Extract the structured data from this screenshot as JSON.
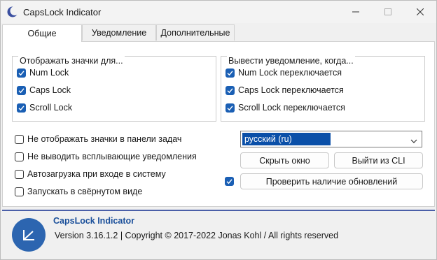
{
  "window": {
    "title": "CapsLock Indicator"
  },
  "tabs": [
    {
      "label": "Общие",
      "active": true
    },
    {
      "label": "Уведомление",
      "active": false
    },
    {
      "label": "Дополнительные",
      "active": false
    }
  ],
  "show_icons": {
    "title": "Отображать значки для...",
    "items": [
      {
        "label": "Num Lock",
        "checked": true
      },
      {
        "label": "Caps Lock",
        "checked": true
      },
      {
        "label": "Scroll Lock",
        "checked": true
      }
    ]
  },
  "notify": {
    "title": "Вывести уведомление, когда...",
    "items": [
      {
        "label": "Num Lock переключается",
        "checked": true
      },
      {
        "label": "Caps Lock переключается",
        "checked": true
      },
      {
        "label": "Scroll Lock переключается",
        "checked": true
      }
    ]
  },
  "options": [
    {
      "label": "Не отображать значки в панели задач",
      "checked": false
    },
    {
      "label": "Не выводить всплывающие уведомления",
      "checked": false
    },
    {
      "label": "Автозагрузка при входе в систему",
      "checked": false
    },
    {
      "label": "Запускать в свёрнутом виде",
      "checked": false
    }
  ],
  "language": {
    "value": "русский (ru)"
  },
  "buttons": {
    "hide_window": "Скрыть окно",
    "exit_cli": "Выйти из CLI",
    "check_updates": "Проверить наличие обновлений"
  },
  "check_updates_checked": true,
  "about": {
    "name": "CapsLock Indicator",
    "version": "Version 3.16.1.2 | Copyright © 2017-2022 Jonas Kohl / All rights reserved"
  },
  "colors": {
    "accent": "#1a5fb4",
    "selection": "#0a4fa8",
    "divider": "#4a5fa8",
    "logo": "#2c65b0"
  },
  "icons": {
    "app": "crescent-moon-icon",
    "minimize": "minimize-icon",
    "maximize": "maximize-icon",
    "close": "close-icon",
    "dropdown": "chevron-down-icon",
    "logo": "capslock-logo-icon"
  }
}
